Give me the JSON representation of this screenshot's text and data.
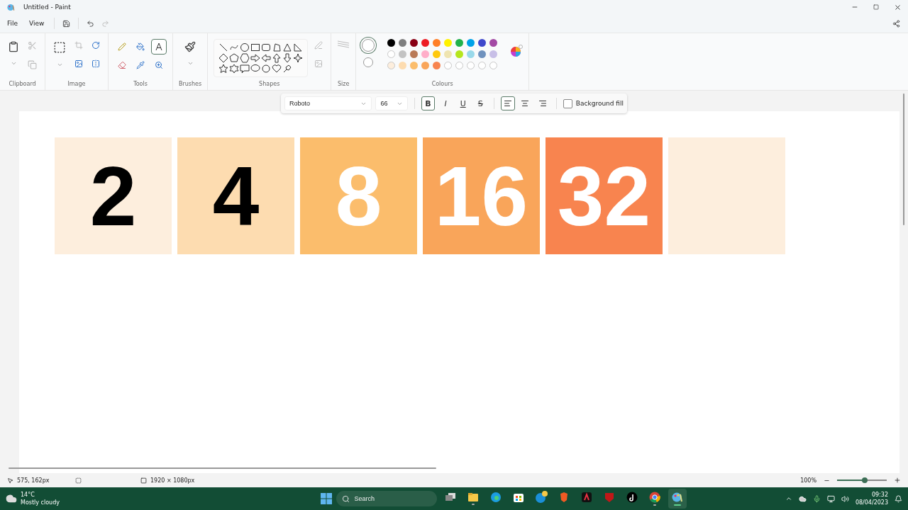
{
  "window": {
    "title": "Untitled - Paint"
  },
  "menu": [
    "File",
    "View"
  ],
  "ribbon": {
    "groups": [
      {
        "kind": "clipboard",
        "label": "Clipboard"
      },
      {
        "kind": "image",
        "label": "Image"
      },
      {
        "kind": "tools",
        "label": "Tools"
      },
      {
        "kind": "brushes",
        "label": "Brushes"
      },
      {
        "kind": "shapes",
        "label": "Shapes"
      },
      {
        "kind": "size",
        "label": "Size"
      },
      {
        "kind": "colours",
        "label": "Colours"
      }
    ],
    "tools": [
      {
        "kind": "pencil",
        "selected": false
      },
      {
        "kind": "fill",
        "selected": false
      },
      {
        "kind": "text",
        "selected": true
      },
      {
        "kind": "eraser",
        "selected": false
      },
      {
        "kind": "picker",
        "selected": false
      },
      {
        "kind": "magnifier",
        "selected": false
      }
    ],
    "palette": [
      {
        "color": "#000000"
      },
      {
        "color": "#7f7f7f"
      },
      {
        "color": "#880015"
      },
      {
        "color": "#ed1c24"
      },
      {
        "color": "#ff7f27"
      },
      {
        "color": "#fff200"
      },
      {
        "color": "#22b14c"
      },
      {
        "color": "#00a2e8"
      },
      {
        "color": "#3f48cc"
      },
      {
        "color": "#a349a4"
      },
      {
        "color": "#ffffff"
      },
      {
        "color": "#c3c3c3"
      },
      {
        "color": "#b97a57"
      },
      {
        "color": "#ffaec9"
      },
      {
        "color": "#ffc90e"
      },
      {
        "color": "#efe4b0"
      },
      {
        "color": "#b5e61d"
      },
      {
        "color": "#99d9ea"
      },
      {
        "color": "#7092be"
      },
      {
        "color": "#c8bfe7"
      },
      {
        "color": "#fdeedd"
      },
      {
        "color": "#fddcb0"
      },
      {
        "color": "#fbbd6c"
      },
      {
        "color": "#f9a55a"
      },
      {
        "color": "#f8844f"
      },
      {
        "color": "#ffffff"
      },
      {
        "color": "#ffffff"
      },
      {
        "color": "#ffffff"
      },
      {
        "color": "#ffffff"
      },
      {
        "color": "#ffffff"
      }
    ]
  },
  "text_toolbar": {
    "font": "Roboto",
    "size": "66",
    "format_buttons": [
      {
        "label": "B",
        "kind": "bold",
        "selected": true
      },
      {
        "label": "I",
        "kind": "italic",
        "selected": false
      },
      {
        "label": "U",
        "kind": "underline",
        "selected": false
      },
      {
        "label": "S",
        "kind": "strike",
        "selected": false
      }
    ],
    "align_buttons": [
      {
        "kind": "left",
        "selected": true
      },
      {
        "kind": "center",
        "selected": false
      },
      {
        "kind": "right",
        "selected": false
      }
    ],
    "background_fill": {
      "label": "Background fill",
      "checked": false
    }
  },
  "canvas": {
    "tiles": [
      {
        "text": "2",
        "color": "#fdeedd",
        "dark_text": true
      },
      {
        "text": "4",
        "color": "#fddcb0",
        "dark_text": true
      },
      {
        "text": "8",
        "color": "#fbbd6c",
        "dark_text": false
      },
      {
        "text": "16",
        "color": "#f9a55a",
        "dark_text": false
      },
      {
        "text": "32",
        "color": "#f8844f",
        "dark_text": false
      },
      {
        "color": "#fdeedd"
      }
    ]
  },
  "status_bar": {
    "position": "575, 162px",
    "canvas_size": "1920 × 1080px",
    "zoom": "100%",
    "zoom_slider": {
      "level": 0.55
    }
  },
  "taskbar": {
    "temperature": "14°C",
    "weather": "Mostly cloudy",
    "search": "Search",
    "apps": [
      {
        "kind": "taskview",
        "running": false,
        "selected": false
      },
      {
        "kind": "explorer",
        "running": true,
        "selected": false
      },
      {
        "kind": "edge",
        "running": false,
        "selected": false
      },
      {
        "kind": "store",
        "running": false,
        "selected": false
      },
      {
        "kind": "help",
        "running": false,
        "selected": false
      },
      {
        "kind": "brave",
        "running": false,
        "selected": false
      },
      {
        "kind": "adobe",
        "running": false,
        "selected": false
      },
      {
        "kind": "shield",
        "running": false,
        "selected": false
      },
      {
        "kind": "tiktok",
        "running": false,
        "selected": false
      },
      {
        "kind": "chrome",
        "running": true,
        "selected": false
      },
      {
        "kind": "paint",
        "running": true,
        "selected": true
      }
    ],
    "time": "09:32",
    "date": "08/04/2023"
  }
}
